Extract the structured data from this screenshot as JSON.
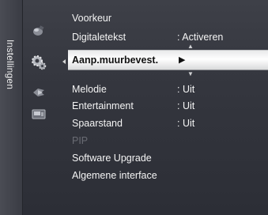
{
  "sidebar": {
    "title": "Instellingen"
  },
  "icons": [
    "picture-icon",
    "setup-gear-icon",
    "sound-icon",
    "input-icon"
  ],
  "menu": {
    "items": [
      {
        "label": "Voorkeur",
        "value": ""
      },
      {
        "label": "Digitaletekst",
        "value": ": Activeren"
      },
      {
        "label": "Aanp.muurbevest.",
        "value": "",
        "selected": true,
        "arrow": "▶"
      },
      {
        "label": "Melodie",
        "value": ": Uit"
      },
      {
        "label": "Entertainment",
        "value": ": Uit"
      },
      {
        "label": "Spaarstand",
        "value": ": Uit"
      },
      {
        "label": "PIP",
        "value": "",
        "disabled": true
      },
      {
        "label": "Software Upgrade",
        "value": ""
      },
      {
        "label": "Algemene interface",
        "value": ""
      }
    ]
  }
}
